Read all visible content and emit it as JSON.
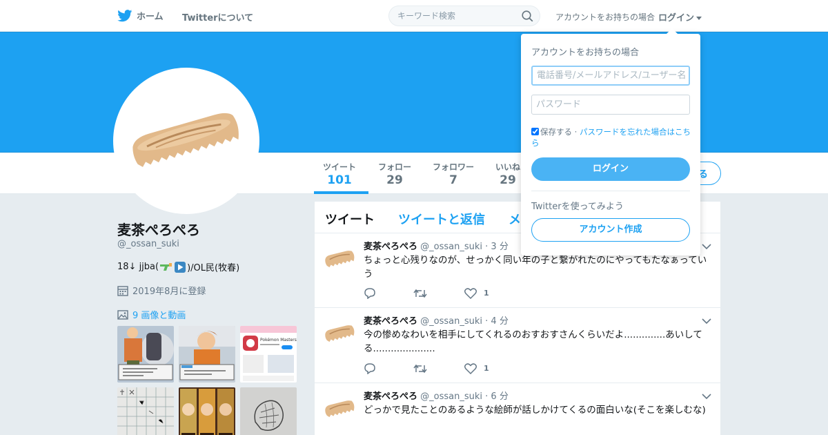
{
  "nav": {
    "home_label": "ホーム",
    "about_label": "Twitterについて",
    "search_placeholder": "キーワード検索",
    "account_prompt": "アカウントをお持ちの場合",
    "login_label": "ログイン"
  },
  "colors": {
    "brand": "#1da1f2",
    "banner": "#1da1f2",
    "page_bg": "#e6ecf0"
  },
  "stats": [
    {
      "label": "ツイート",
      "value": "101"
    },
    {
      "label": "フォロー",
      "value": "29"
    },
    {
      "label": "フォロワー",
      "value": "7"
    },
    {
      "label": "いいね",
      "value": "29"
    }
  ],
  "follow_button_partial": "る",
  "profile": {
    "name": "麦茶ぺろぺろ",
    "handle": "@_ossan_suki",
    "bio_prefix": "18↓ jjba(",
    "bio_suffix": ")/OL民(牧春)",
    "joined": "2019年8月に登録",
    "media_link": "9 画像と動画"
  },
  "timeline": {
    "tabs": [
      "ツイート",
      "ツイートと返信",
      "メ"
    ],
    "tweets": [
      {
        "name": "麦茶ぺろぺろ",
        "handle": "@_ossan_suki",
        "time": "· 3 分",
        "text": "ちょっと心残りなのが、せっかく同い年の子と繋がれたのにやってもたなぁってい う",
        "likes": "1"
      },
      {
        "name": "麦茶ぺろぺろ",
        "handle": "@_ossan_suki",
        "time": "· 4 分",
        "text": "今の惨めなわいを相手にしてくれるのおすおすさんくらいだよ..............あいしてる.....................",
        "likes": "1"
      },
      {
        "name": "麦茶ぺろぺろ",
        "handle": "@_ossan_suki",
        "time": "· 6 分",
        "text": "どっかで見たことのあるような絵師が話しかけてくるの面白いな(そこを楽しむな)",
        "likes": ""
      }
    ]
  },
  "thumb_texts": {
    "pokemon_masters": "Pokémon Masters"
  },
  "login_dropdown": {
    "title": "アカウントをお持ちの場合",
    "username_placeholder": "電話番号/メールアドレス/ユーザー名",
    "password_placeholder": "パスワード",
    "remember_label": "保存する",
    "forgot_link": "パスワードを忘れた場合はこちら",
    "login_button": "ログイン",
    "try_label": "Twitterを使ってみよう",
    "signup_button": "アカウント作成"
  }
}
